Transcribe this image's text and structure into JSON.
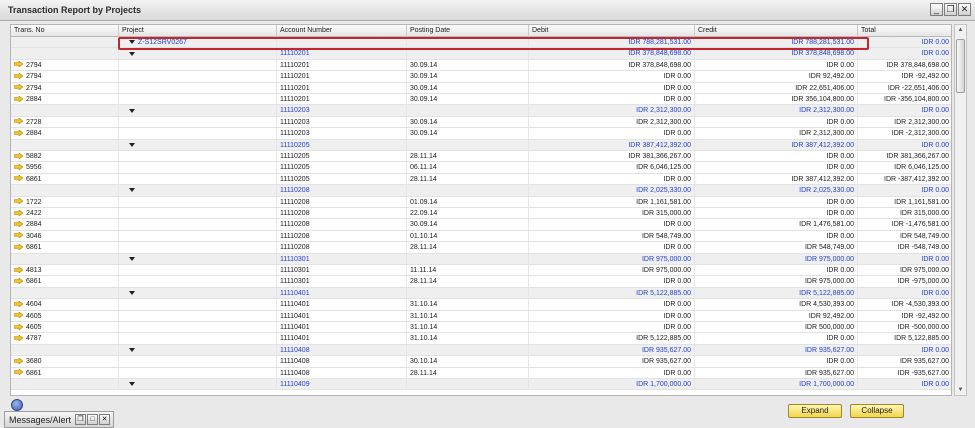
{
  "window": {
    "title": "Transaction Report by Projects"
  },
  "icons": {
    "minimize": "minimize-icon",
    "restore": "restore-icon",
    "close": "close-icon",
    "row_arrow": "yellow-arrow-icon",
    "expand_triangle": "triangle-down-icon"
  },
  "colors": {
    "accent_blue": "#1f3fd8",
    "highlight_red": "#c0282d",
    "arrow_yellow": "#f2c22b",
    "button_yellow": "#f2d54a"
  },
  "columns": [
    "Trans. No",
    "Project",
    "Account Number",
    "Posting Date",
    "Debit",
    "Credit",
    "Total"
  ],
  "rows": [
    {
      "type": "project",
      "trans": "",
      "project": "Z-S12SRV0267",
      "account": "",
      "date": "",
      "debit": "IDR 788,281,531.00",
      "credit": "IDR 788,281,531.00",
      "total": "IDR 0.00"
    },
    {
      "type": "group",
      "trans": "",
      "project": "",
      "account": "11110201",
      "date": "",
      "debit": "IDR 378,848,698.00",
      "credit": "IDR 378,848,698.00",
      "total": "IDR 0.00"
    },
    {
      "type": "detail",
      "trans": "2794",
      "project": "",
      "account": "11110201",
      "date": "30.09.14",
      "debit": "IDR 378,848,698.00",
      "credit": "IDR 0.00",
      "total": "IDR 378,848,698.00"
    },
    {
      "type": "detail",
      "trans": "2794",
      "project": "",
      "account": "11110201",
      "date": "30.09.14",
      "debit": "IDR 0.00",
      "credit": "IDR 92,492.00",
      "total": "IDR -92,492.00"
    },
    {
      "type": "detail",
      "trans": "2794",
      "project": "",
      "account": "11110201",
      "date": "30.09.14",
      "debit": "IDR 0.00",
      "credit": "IDR 22,651,406.00",
      "total": "IDR -22,651,406.00"
    },
    {
      "type": "detail",
      "trans": "2884",
      "project": "",
      "account": "11110201",
      "date": "30.09.14",
      "debit": "IDR 0.00",
      "credit": "IDR 356,104,800.00",
      "total": "IDR -356,104,800.00"
    },
    {
      "type": "group",
      "trans": "",
      "project": "",
      "account": "11110203",
      "date": "",
      "debit": "IDR 2,312,300.00",
      "credit": "IDR 2,312,300.00",
      "total": "IDR 0.00"
    },
    {
      "type": "detail",
      "trans": "2728",
      "project": "",
      "account": "11110203",
      "date": "30.09.14",
      "debit": "IDR 2,312,300.00",
      "credit": "IDR 0.00",
      "total": "IDR 2,312,300.00"
    },
    {
      "type": "detail",
      "trans": "2884",
      "project": "",
      "account": "11110203",
      "date": "30.09.14",
      "debit": "IDR 0.00",
      "credit": "IDR 2,312,300.00",
      "total": "IDR -2,312,300.00"
    },
    {
      "type": "group",
      "trans": "",
      "project": "",
      "account": "11110205",
      "date": "",
      "debit": "IDR 387,412,392.00",
      "credit": "IDR 387,412,392.00",
      "total": "IDR 0.00"
    },
    {
      "type": "detail",
      "trans": "5882",
      "project": "",
      "account": "11110205",
      "date": "28.11.14",
      "debit": "IDR 381,366,267.00",
      "credit": "IDR 0.00",
      "total": "IDR 381,366,267.00"
    },
    {
      "type": "detail",
      "trans": "5956",
      "project": "",
      "account": "11110205",
      "date": "06.11.14",
      "debit": "IDR 6,046,125.00",
      "credit": "IDR 0.00",
      "total": "IDR 6,046,125.00"
    },
    {
      "type": "detail",
      "trans": "6861",
      "project": "",
      "account": "11110205",
      "date": "28.11.14",
      "debit": "IDR 0.00",
      "credit": "IDR 387,412,392.00",
      "total": "IDR -387,412,392.00"
    },
    {
      "type": "group",
      "trans": "",
      "project": "",
      "account": "11110208",
      "date": "",
      "debit": "IDR 2,025,330.00",
      "credit": "IDR 2,025,330.00",
      "total": "IDR 0.00"
    },
    {
      "type": "detail",
      "trans": "1722",
      "project": "",
      "account": "11110208",
      "date": "01.09.14",
      "debit": "IDR 1,161,581.00",
      "credit": "IDR 0.00",
      "total": "IDR 1,161,581.00"
    },
    {
      "type": "detail",
      "trans": "2422",
      "project": "",
      "account": "11110208",
      "date": "22.09.14",
      "debit": "IDR 315,000.00",
      "credit": "IDR 0.00",
      "total": "IDR 315,000.00"
    },
    {
      "type": "detail",
      "trans": "2884",
      "project": "",
      "account": "11110208",
      "date": "30.09.14",
      "debit": "IDR 0.00",
      "credit": "IDR 1,476,581.00",
      "total": "IDR -1,476,581.00"
    },
    {
      "type": "detail",
      "trans": "3046",
      "project": "",
      "account": "11110208",
      "date": "01.10.14",
      "debit": "IDR 548,749.00",
      "credit": "IDR 0.00",
      "total": "IDR 548,749.00"
    },
    {
      "type": "detail",
      "trans": "6861",
      "project": "",
      "account": "11110208",
      "date": "28.11.14",
      "debit": "IDR 0.00",
      "credit": "IDR 548,749.00",
      "total": "IDR -548,749.00"
    },
    {
      "type": "group",
      "trans": "",
      "project": "",
      "account": "11110301",
      "date": "",
      "debit": "IDR 975,000.00",
      "credit": "IDR 975,000.00",
      "total": "IDR 0.00"
    },
    {
      "type": "detail",
      "trans": "4813",
      "project": "",
      "account": "11110301",
      "date": "11.11.14",
      "debit": "IDR 975,000.00",
      "credit": "IDR 0.00",
      "total": "IDR 975,000.00"
    },
    {
      "type": "detail",
      "trans": "6861",
      "project": "",
      "account": "11110301",
      "date": "28.11.14",
      "debit": "IDR 0.00",
      "credit": "IDR 975,000.00",
      "total": "IDR -975,000.00"
    },
    {
      "type": "group",
      "trans": "",
      "project": "",
      "account": "11110401",
      "date": "",
      "debit": "IDR 5,122,885.00",
      "credit": "IDR 5,122,885.00",
      "total": "IDR 0.00"
    },
    {
      "type": "detail",
      "trans": "4604",
      "project": "",
      "account": "11110401",
      "date": "31.10.14",
      "debit": "IDR 0.00",
      "credit": "IDR 4,530,393.00",
      "total": "IDR -4,530,393.00"
    },
    {
      "type": "detail",
      "trans": "4605",
      "project": "",
      "account": "11110401",
      "date": "31.10.14",
      "debit": "IDR 0.00",
      "credit": "IDR 92,492.00",
      "total": "IDR -92,492.00"
    },
    {
      "type": "detail",
      "trans": "4605",
      "project": "",
      "account": "11110401",
      "date": "31.10.14",
      "debit": "IDR 0.00",
      "credit": "IDR 500,000.00",
      "total": "IDR -500,000.00"
    },
    {
      "type": "detail",
      "trans": "4787",
      "project": "",
      "account": "11110401",
      "date": "31.10.14",
      "debit": "IDR 5,122,885.00",
      "credit": "IDR 0.00",
      "total": "IDR 5,122,885.00"
    },
    {
      "type": "group",
      "trans": "",
      "project": "",
      "account": "11110408",
      "date": "",
      "debit": "IDR 935,627.00",
      "credit": "IDR 935,627.00",
      "total": "IDR 0.00"
    },
    {
      "type": "detail",
      "trans": "3680",
      "project": "",
      "account": "11110408",
      "date": "30.10.14",
      "debit": "IDR 935,627.00",
      "credit": "IDR 0.00",
      "total": "IDR 935,627.00"
    },
    {
      "type": "detail",
      "trans": "6861",
      "project": "",
      "account": "11110408",
      "date": "28.11.14",
      "debit": "IDR 0.00",
      "credit": "IDR 935,627.00",
      "total": "IDR -935,627.00"
    },
    {
      "type": "group",
      "trans": "",
      "project": "",
      "account": "11110409",
      "date": "",
      "debit": "IDR 1,700,000.00",
      "credit": "IDR 1,700,000.00",
      "total": "IDR 0.00"
    }
  ],
  "buttons": {
    "expand": "Expand",
    "collapse": "Collapse"
  },
  "messages_bar": {
    "label": "Messages/Alert"
  }
}
